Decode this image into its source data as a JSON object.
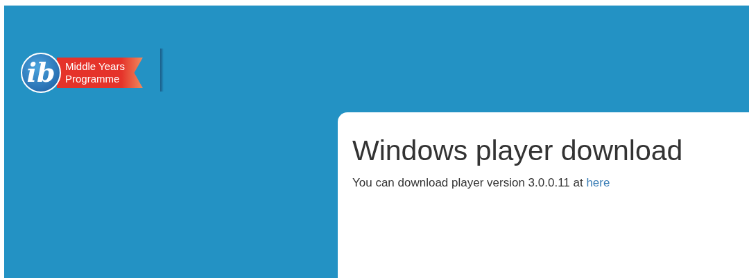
{
  "logo": {
    "mark": "ib",
    "lines": [
      "Middle Years",
      "Programme"
    ]
  },
  "card": {
    "title": "Windows player download",
    "text": "You can download player version 3.0.0.11 at ",
    "link": "here"
  }
}
